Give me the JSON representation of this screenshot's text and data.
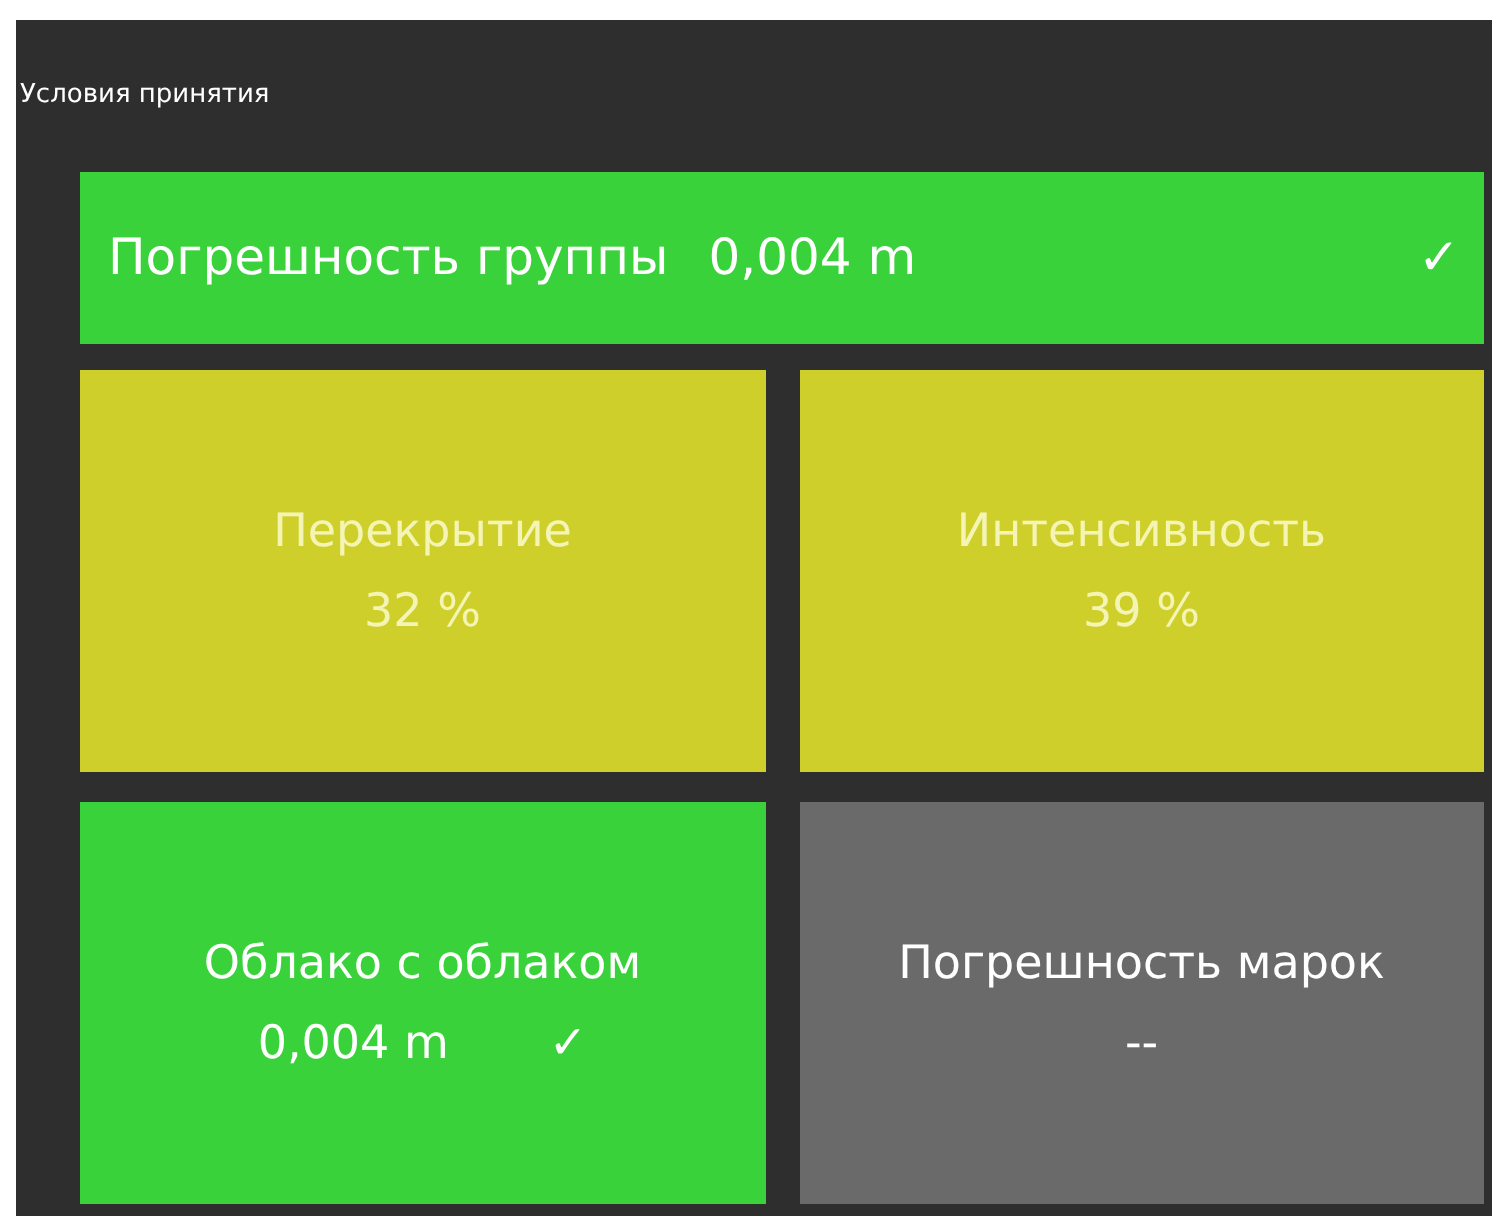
{
  "panel": {
    "title": "Условия принятия"
  },
  "summary": {
    "label": "Погрешность группы",
    "value": "0,004 m",
    "color": "#3ad23a",
    "mark": "✓"
  },
  "tiles": [
    {
      "label": "Перекрытие",
      "value": "32 %",
      "color": "#cfcf2c"
    },
    {
      "label": "Интенсивность",
      "value": "39 %",
      "color": "#cfcf2c"
    },
    {
      "label": "Облако с облаком",
      "value": "0,004 m",
      "color": "#3ad23a",
      "mark": "✓"
    },
    {
      "label": "Погрешность марок",
      "value": "--",
      "color": "#6a6a6a"
    }
  ]
}
